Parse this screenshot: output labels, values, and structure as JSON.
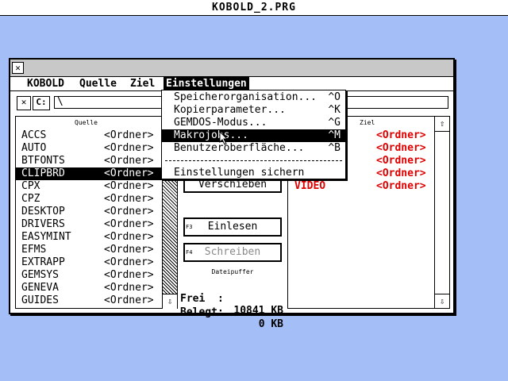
{
  "screen_title": "KOBOLD_2.PRG",
  "window": {
    "menubar": [
      {
        "label": "KOBOLD"
      },
      {
        "label": "Quelle"
      },
      {
        "label": "Ziel"
      },
      {
        "label": "Einstellungen"
      }
    ],
    "path": {
      "drive_label": "C:",
      "value": "\\"
    }
  },
  "source_pane": {
    "title": "Quelle",
    "items": [
      {
        "name": "ACCS",
        "type": "<Ordner>"
      },
      {
        "name": "AUTO",
        "type": "<Ordner>"
      },
      {
        "name": "BTFONTS",
        "type": "<Ordner>"
      },
      {
        "name": "CLIPBRD",
        "type": "<Ordner>",
        "selected": true
      },
      {
        "name": "CPX",
        "type": "<Ordner>"
      },
      {
        "name": "CPZ",
        "type": "<Ordner>"
      },
      {
        "name": "DESKTOP",
        "type": "<Ordner>"
      },
      {
        "name": "DRIVERS",
        "type": "<Ordner>"
      },
      {
        "name": "EASYMINT",
        "type": "<Ordner>"
      },
      {
        "name": "EFMS",
        "type": "<Ordner>"
      },
      {
        "name": "EXTRAPP",
        "type": "<Ordner>"
      },
      {
        "name": "GEMSYS",
        "type": "<Ordner>"
      },
      {
        "name": "GENEVA",
        "type": "<Ordner>"
      },
      {
        "name": "GUIDES",
        "type": "<Ordner>"
      }
    ]
  },
  "dest_pane": {
    "title": "Ziel",
    "items": [
      {
        "name": "",
        "type": "<Ordner>"
      },
      {
        "name": "",
        "type": "<Ordner>"
      },
      {
        "name": "",
        "type": "<Ordner>"
      },
      {
        "name": "",
        "type": "<Ordner>"
      },
      {
        "name": "VIDEO",
        "type": "<Ordner>"
      }
    ]
  },
  "middle": {
    "move_button": "Verschieben",
    "read_button": {
      "label": "Einlesen",
      "fkey": "F3"
    },
    "write_button": {
      "label": "Schreiben",
      "fkey": "F4"
    },
    "buffer_title": "Dateipuffer",
    "free_label": "Frei  :",
    "free_value": "10841 KB",
    "used_label": "Belegt:",
    "used_value": "0 KB"
  },
  "dropdown": {
    "items": [
      {
        "label": "Speicherorganisation...",
        "shortcut": "^O"
      },
      {
        "label": "Kopierparameter...",
        "shortcut": "^K"
      },
      {
        "label": "GEMDOS-Modus...",
        "shortcut": "^G"
      },
      {
        "label": "Makrojobs...",
        "shortcut": "^M",
        "highlighted": true
      },
      {
        "label": "Benutzeroberfläche...",
        "shortcut": "^B"
      },
      {
        "label": "Einstellungen sichern",
        "shortcut": ""
      }
    ]
  },
  "colors": {
    "desktop": "#a4bff8",
    "dest_text": "#e00000"
  },
  "icons": {
    "closer": "close-box-icon",
    "scroll_up": "arrow-up-icon",
    "scroll_down": "arrow-down-icon",
    "cursor": "mouse-pointer-icon"
  }
}
